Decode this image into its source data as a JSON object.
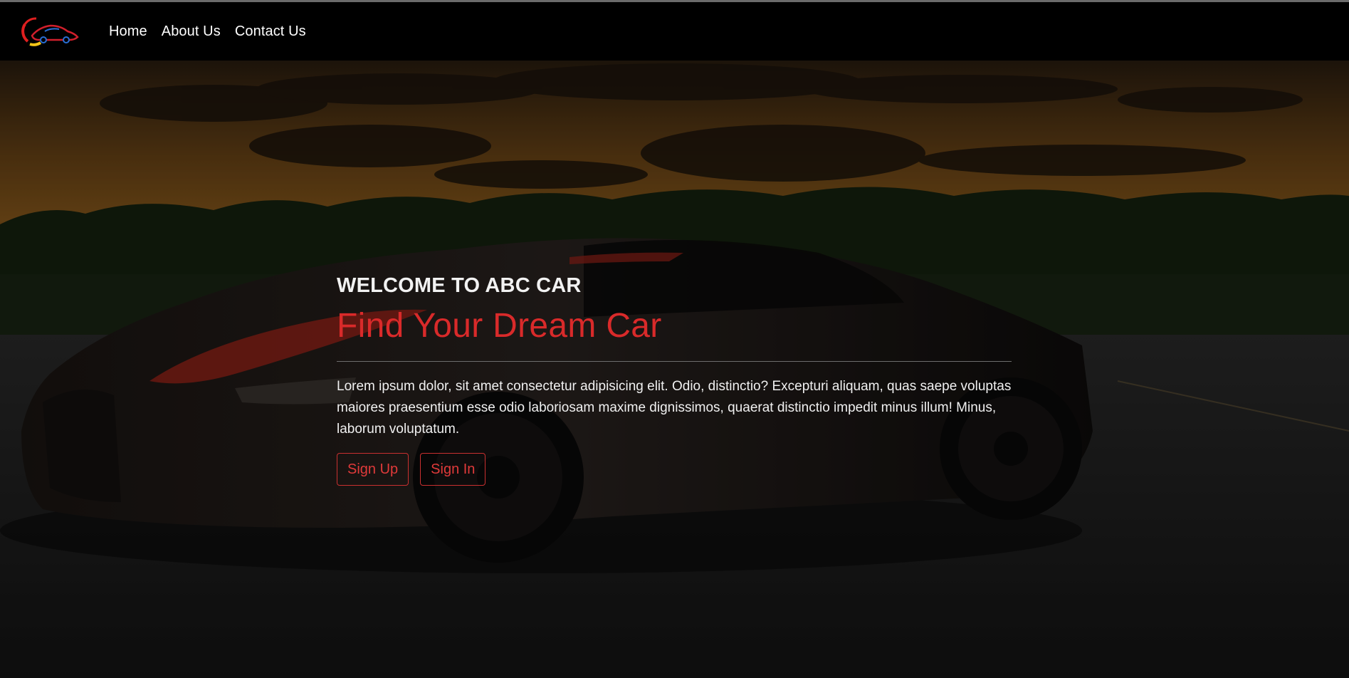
{
  "brand": {
    "logo_icon": "sports-car-logo-icon",
    "accent": "#d92a2a"
  },
  "nav": {
    "items": [
      {
        "label": "Home"
      },
      {
        "label": "About Us"
      },
      {
        "label": "Contact Us"
      }
    ]
  },
  "hero": {
    "eyebrow": "WELCOME TO ABC CAR",
    "headline": "Find Your Dream Car",
    "body": "Lorem ipsum dolor, sit amet consectetur adipisicing elit. Odio, distinctio? Excepturi aliquam, quas saepe voluptas maiores praesentium esse odio laboriosam maxime dignissimos, quaerat distinctio impedit minus illum! Minus, laborum voluptatum.",
    "buttons": {
      "signup_label": "Sign Up",
      "signin_label": "Sign In"
    }
  }
}
